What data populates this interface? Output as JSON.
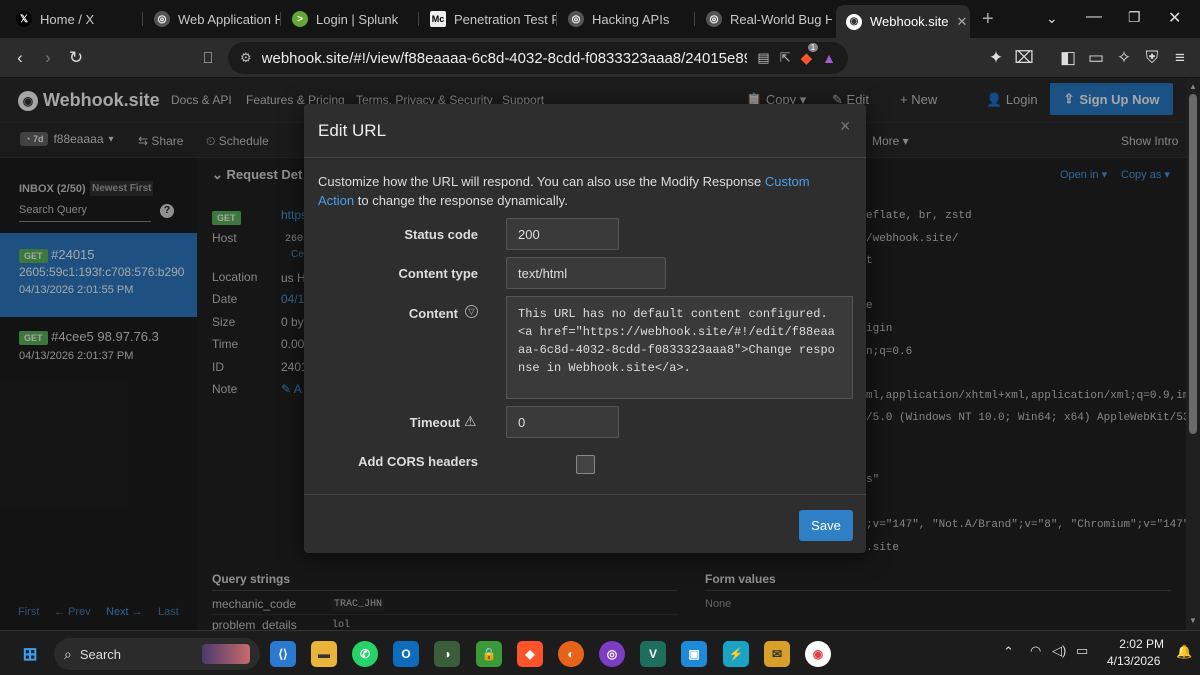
{
  "browser": {
    "tabs": [
      {
        "title": "Home / X",
        "icon": "x-logo-icon"
      },
      {
        "title": "Web Application H",
        "icon": "globe-icon"
      },
      {
        "title": "Login | Splunk",
        "icon": "splunk-icon"
      },
      {
        "title": "Penetration Test R",
        "icon": "mc-icon"
      },
      {
        "title": "Hacking APIs",
        "icon": "globe-icon"
      },
      {
        "title": "Real-World Bug H",
        "icon": "globe-icon"
      },
      {
        "title": "Webhook.site",
        "icon": "webhook-icon"
      }
    ],
    "url": "webhook.site/#!/view/f88eaaaa-6c8d-4032-8cdd-f0833323aaa8/24015e89-bbad-406f-...",
    "brave_shield_count": "1"
  },
  "site": {
    "logo": "Webhook.site",
    "nav": [
      "Docs & API",
      "Features & Pricing",
      "Terms, Privacy & Security",
      "Support"
    ],
    "copy_label": "Copy",
    "edit_label": "Edit",
    "new_label": "New",
    "login_label": "Login",
    "signup_label": "Sign Up Now",
    "subbar": {
      "age": "7d",
      "token": "f88eaaaa",
      "share": "Share",
      "schedule": "Schedule",
      "more": "More",
      "show_intro": "Show Intro"
    }
  },
  "inbox": {
    "title": "INBOX (2/50)",
    "sort": "Newest First",
    "search_placeholder": "Search Query",
    "help": "?",
    "requests": [
      {
        "method": "GET",
        "id": "#24015",
        "ip": "2605:59c1:193f:c708:576:b290",
        "time": "04/13/2026 2:01:55 PM"
      },
      {
        "method": "GET",
        "id": "#4cee5",
        "ip": "98.97.76.3",
        "time": "04/13/2026 2:01:37 PM"
      }
    ],
    "pager": {
      "first": "First",
      "prev": "← Prev",
      "next": "Next →",
      "last": "Last"
    }
  },
  "details": {
    "heading": "Request Det",
    "method": "GET",
    "url_fragment": "https",
    "rows": [
      {
        "label": "Host",
        "value": "2605"
      },
      {
        "label": "Location",
        "value": "us H"
      },
      {
        "label": "Date",
        "value": "04/1"
      },
      {
        "label": "Size",
        "value": "0 by"
      },
      {
        "label": "Time",
        "value": "0.00"
      },
      {
        "label": "ID",
        "value": "2401"
      },
      {
        "label": "Note",
        "value": "A"
      }
    ],
    "host_sub": "Ce",
    "open_in": "Open in",
    "copy_as": "Copy as",
    "headers_text": [
      "eflate, br, zstd",
      "/webhook.site/",
      "t",
      "e",
      "igin",
      "n;q=0.6",
      "ml,application/xhtml+xml,application/xml;q=0.9,im...",
      "/5.0 (Windows NT 10.0; Win64; x64) AppleWebKit/53...",
      "s\"",
      ";v=\"147\", \"Not.A/Brand\";v=\"8\", \"Chromium\";v=\"147\"",
      ".site"
    ],
    "query_strings_title": "Query strings",
    "query": [
      {
        "key": "mechanic_code",
        "value": "TRAC_JHN"
      },
      {
        "key": "problem_details",
        "value": "lol"
      }
    ],
    "form_values_title": "Form values",
    "form_values": "None"
  },
  "modal": {
    "title": "Edit URL",
    "close": "×",
    "intro_before": "Customize how the URL will respond. You can also use the Modify Response ",
    "intro_link": "Custom Action",
    "intro_after": " to change the response dynamically.",
    "status_label": "Status code",
    "status_value": "200",
    "content_type_label": "Content type",
    "content_type_value": "text/html",
    "content_label": "Content",
    "content_value": "This URL has no default content configured. <a href=\"https://webhook.site/#!/edit/f88eaaaa-6c8d-4032-8cdd-f0833323aaa8\">Change response in Webhook.site</a>.",
    "timeout_label": "Timeout",
    "timeout_value": "0",
    "cors_label": "Add CORS headers",
    "cors_checked": false,
    "save_label": "Save"
  },
  "taskbar": {
    "search_label": "Search",
    "time": "2:02 PM",
    "date": "4/13/2026"
  }
}
